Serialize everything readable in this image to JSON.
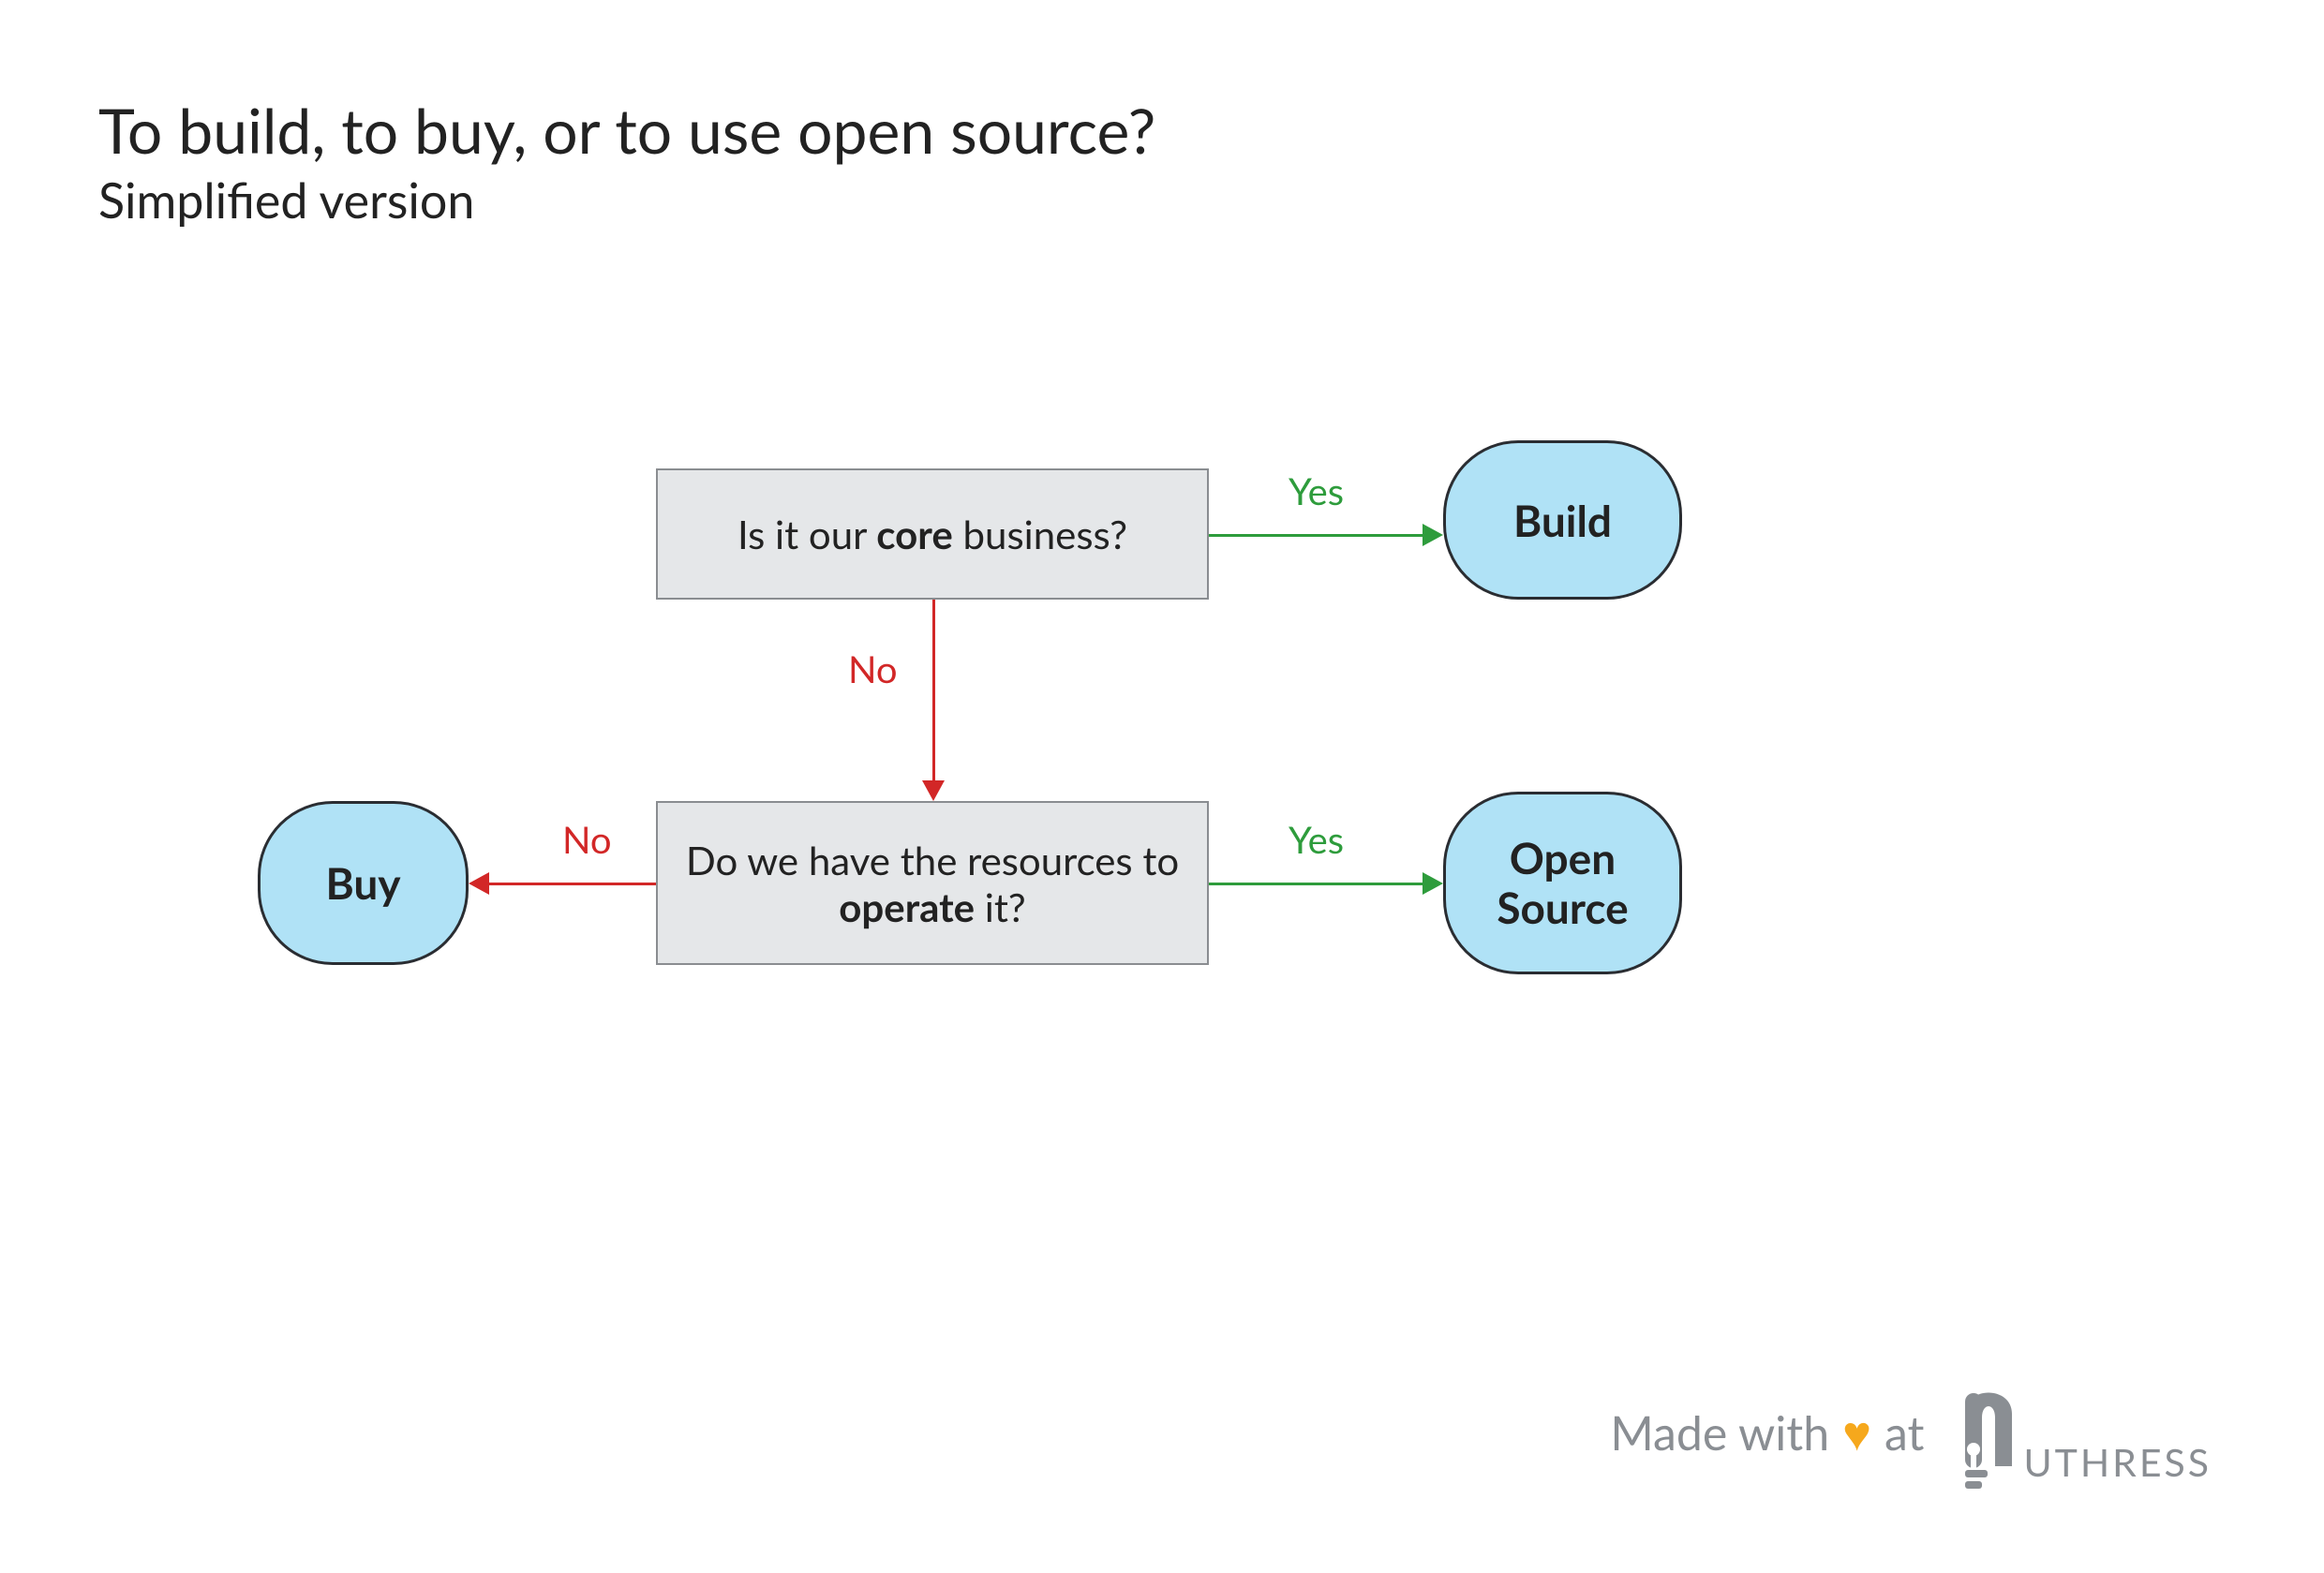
{
  "title": "To build, to buy, or to use open source?",
  "subtitle": "Simplified version",
  "decisions": {
    "q1": {
      "prefix": "Is it our ",
      "bold": "core",
      "suffix": " business?"
    },
    "q2": {
      "prefix": "Do we have the resources to ",
      "bold": "operate",
      "suffix": " it?"
    }
  },
  "terminals": {
    "build": "Build",
    "open_source": "Open Source",
    "buy": "Buy"
  },
  "edges": {
    "q1_yes": "Yes",
    "q1_no": "No",
    "q2_yes": "Yes",
    "q2_no": "No"
  },
  "footer": {
    "made_with": "Made with",
    "at": "at",
    "brand_tail": "uthress"
  },
  "colors": {
    "yes": "#2e9c3c",
    "no": "#d22727",
    "box_fill": "#e5e7e9",
    "box_border": "#8a8d91",
    "terminal_fill": "#b0e2f6",
    "terminal_border": "#2a2d32",
    "heart": "#f6a81c",
    "footer_text": "#8a8e93"
  },
  "chart_data": {
    "type": "flowchart",
    "nodes": [
      {
        "id": "q1",
        "kind": "decision",
        "text": "Is it our core business?"
      },
      {
        "id": "q2",
        "kind": "decision",
        "text": "Do we have the resources to operate it?"
      },
      {
        "id": "build",
        "kind": "terminal",
        "text": "Build"
      },
      {
        "id": "open_source",
        "kind": "terminal",
        "text": "Open Source"
      },
      {
        "id": "buy",
        "kind": "terminal",
        "text": "Buy"
      }
    ],
    "edges": [
      {
        "from": "q1",
        "to": "build",
        "label": "Yes"
      },
      {
        "from": "q1",
        "to": "q2",
        "label": "No"
      },
      {
        "from": "q2",
        "to": "open_source",
        "label": "Yes"
      },
      {
        "from": "q2",
        "to": "buy",
        "label": "No"
      }
    ]
  }
}
